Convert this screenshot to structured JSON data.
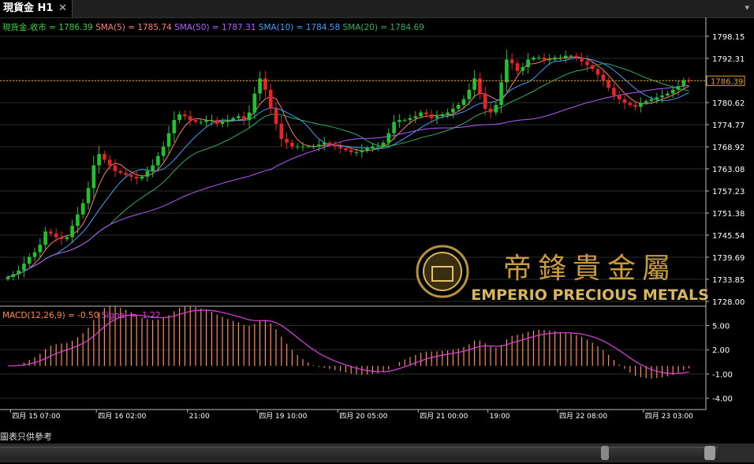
{
  "window": {
    "tab_label": "現貨金 H1",
    "close_glyph": "✕",
    "footer_note": "圖表只供參考"
  },
  "price_legend": [
    {
      "label": "現貨金.收市",
      "value": "1786.39",
      "color": "#3fcf3f"
    },
    {
      "label": "SMA(5)",
      "value": "1785.74",
      "color": "#ff7e6b"
    },
    {
      "label": "SMA(50)",
      "value": "1787.31",
      "color": "#b45cff"
    },
    {
      "label": "SMA(10)",
      "value": "1784.58",
      "color": "#3f9fff"
    },
    {
      "label": "SMA(20)",
      "value": "1784.69",
      "color": "#2fae5f"
    }
  ],
  "watermark": {
    "chinese": "帝鋒貴金屬",
    "english": "EMPERIO PRECIOUS METALS"
  },
  "chart_data": [
    {
      "type": "candlestick",
      "y_ticks": [
        "1798.15",
        "1792.31",
        "1786.46",
        "1780.62",
        "1774.77",
        "1768.92",
        "1763.08",
        "1757.23",
        "1751.38",
        "1745.54",
        "1739.69",
        "1733.85",
        "1728.00"
      ],
      "ylim": [
        1728.0,
        1798.15
      ],
      "last_price": 1786.39,
      "last_price_label": "1786.39",
      "x_tick_labels": [
        "四月 15 07:00",
        "四月 16 02:00",
        "21:00",
        "四月 19 10:00",
        "四月 20 05:00",
        "四月 21 00:00",
        "19:00",
        "四月 22 08:00",
        "四月 23 03:00"
      ],
      "x_tick_positions": [
        0.5,
        16.5,
        33.5,
        46.5,
        61.5,
        76.5,
        89.5,
        102.5,
        118.5
      ],
      "close_path": [
        1734.5,
        1735.2,
        1736.2,
        1738,
        1739.8,
        1741,
        1743,
        1746.5,
        1746,
        1745,
        1744.5,
        1745,
        1748,
        1751,
        1754,
        1758,
        1764,
        1767,
        1765.5,
        1764,
        1762.5,
        1762,
        1761.5,
        1761,
        1760.5,
        1761,
        1762.5,
        1764,
        1766.5,
        1769,
        1772.5,
        1776,
        1777.5,
        1777,
        1776,
        1775.5,
        1775.5,
        1776,
        1776,
        1775,
        1775.5,
        1776,
        1776.5,
        1777,
        1776,
        1778,
        1783,
        1787,
        1784,
        1779,
        1775,
        1771,
        1770,
        1769,
        1769,
        1769,
        1769,
        1769,
        1769.5,
        1770,
        1769.5,
        1769,
        1768.5,
        1768,
        1767.5,
        1767.5,
        1768,
        1768.5,
        1769,
        1769,
        1770,
        1772.5,
        1775.5,
        1776,
        1776,
        1776.5,
        1777,
        1778,
        1777.5,
        1776.5,
        1777,
        1777.5,
        1778,
        1779,
        1780,
        1781.5,
        1784,
        1787,
        1783,
        1779,
        1778,
        1780,
        1786,
        1792,
        1791,
        1789,
        1790,
        1792,
        1792.5,
        1792.5,
        1792,
        1792,
        1792.5,
        1792.5,
        1793,
        1793,
        1792.5,
        1791.5,
        1790.5,
        1789.5,
        1788,
        1786.5,
        1784.5,
        1782.5,
        1781.5,
        1780.5,
        1780,
        1779.5,
        1780.5,
        1781,
        1781.5,
        1782,
        1782.5,
        1783,
        1784,
        1785,
        1786.5,
        1786.39
      ],
      "macd": {
        "label": "MACD(12,26,9) = -0.50",
        "signal_label": "Signal = -1.22",
        "y_ticks": [
          "5.00",
          "2.00",
          "-1.00",
          "-4.00"
        ],
        "ylim": [
          -5.2,
          6.8
        ],
        "macd_color": "#ff8a4a",
        "signal_color": "#e040e0"
      }
    }
  ]
}
